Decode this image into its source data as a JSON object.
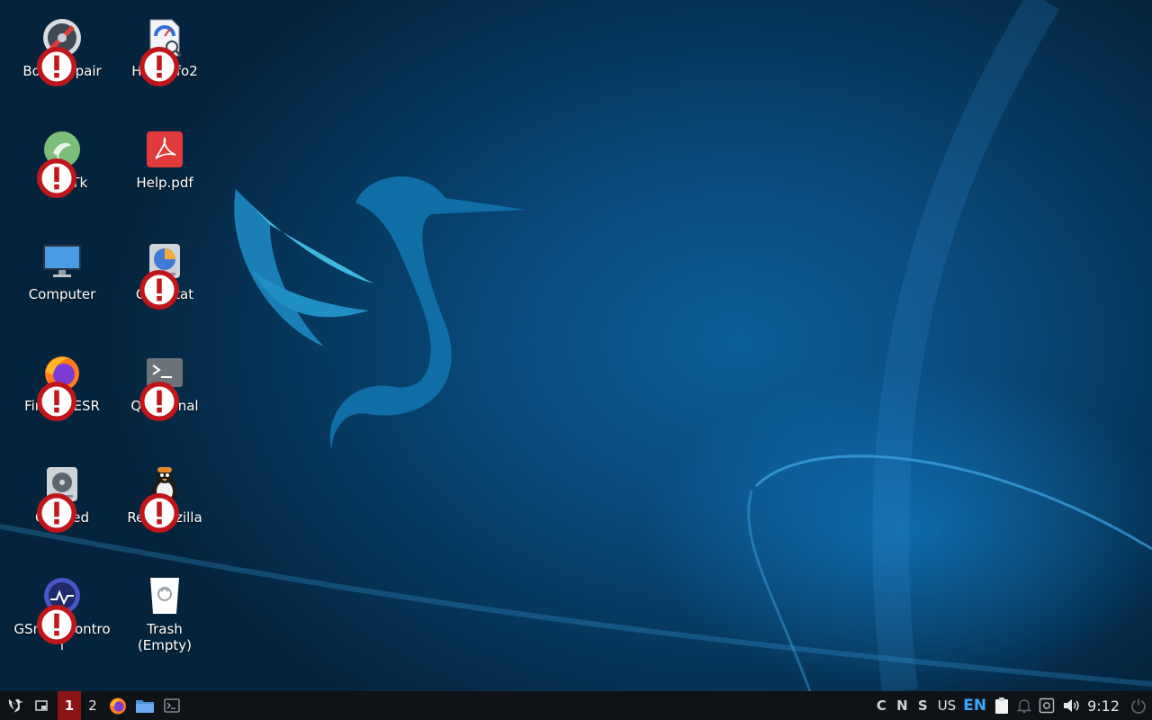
{
  "desktop": {
    "icons": [
      {
        "label": "Boot Repair",
        "icon": "boot-repair-icon"
      },
      {
        "label": "Hardinfo2",
        "icon": "hardinfo-icon"
      },
      {
        "label": "ClamTk",
        "icon": "clamtk-icon"
      },
      {
        "label": "Help.pdf",
        "icon": "pdf-icon"
      },
      {
        "label": "Computer",
        "icon": "monitor-icon"
      },
      {
        "label": "QDirStat",
        "icon": "qdirstat-icon"
      },
      {
        "label": "Firefox ESR",
        "icon": "firefox-icon"
      },
      {
        "label": "QTerminal",
        "icon": "terminal-icon"
      },
      {
        "label": "GParted",
        "icon": "gparted-icon"
      },
      {
        "label": "Rescuezilla",
        "icon": "rescuezilla-icon"
      },
      {
        "label": "GSmartControl",
        "icon": "gsmartcontrol-icon"
      },
      {
        "label": "Trash\n(Empty)",
        "icon": "trash-icon"
      }
    ]
  },
  "taskbar": {
    "workspaces": [
      "1",
      "2"
    ],
    "keyboard_locks": "C N S",
    "keyboard_layout": "US",
    "language": "EN",
    "clock": "9:12"
  },
  "colors": {
    "taskbar_bg": "#0f1317",
    "active_workspace": "#8b1414",
    "language_accent": "#3aa7ff"
  }
}
